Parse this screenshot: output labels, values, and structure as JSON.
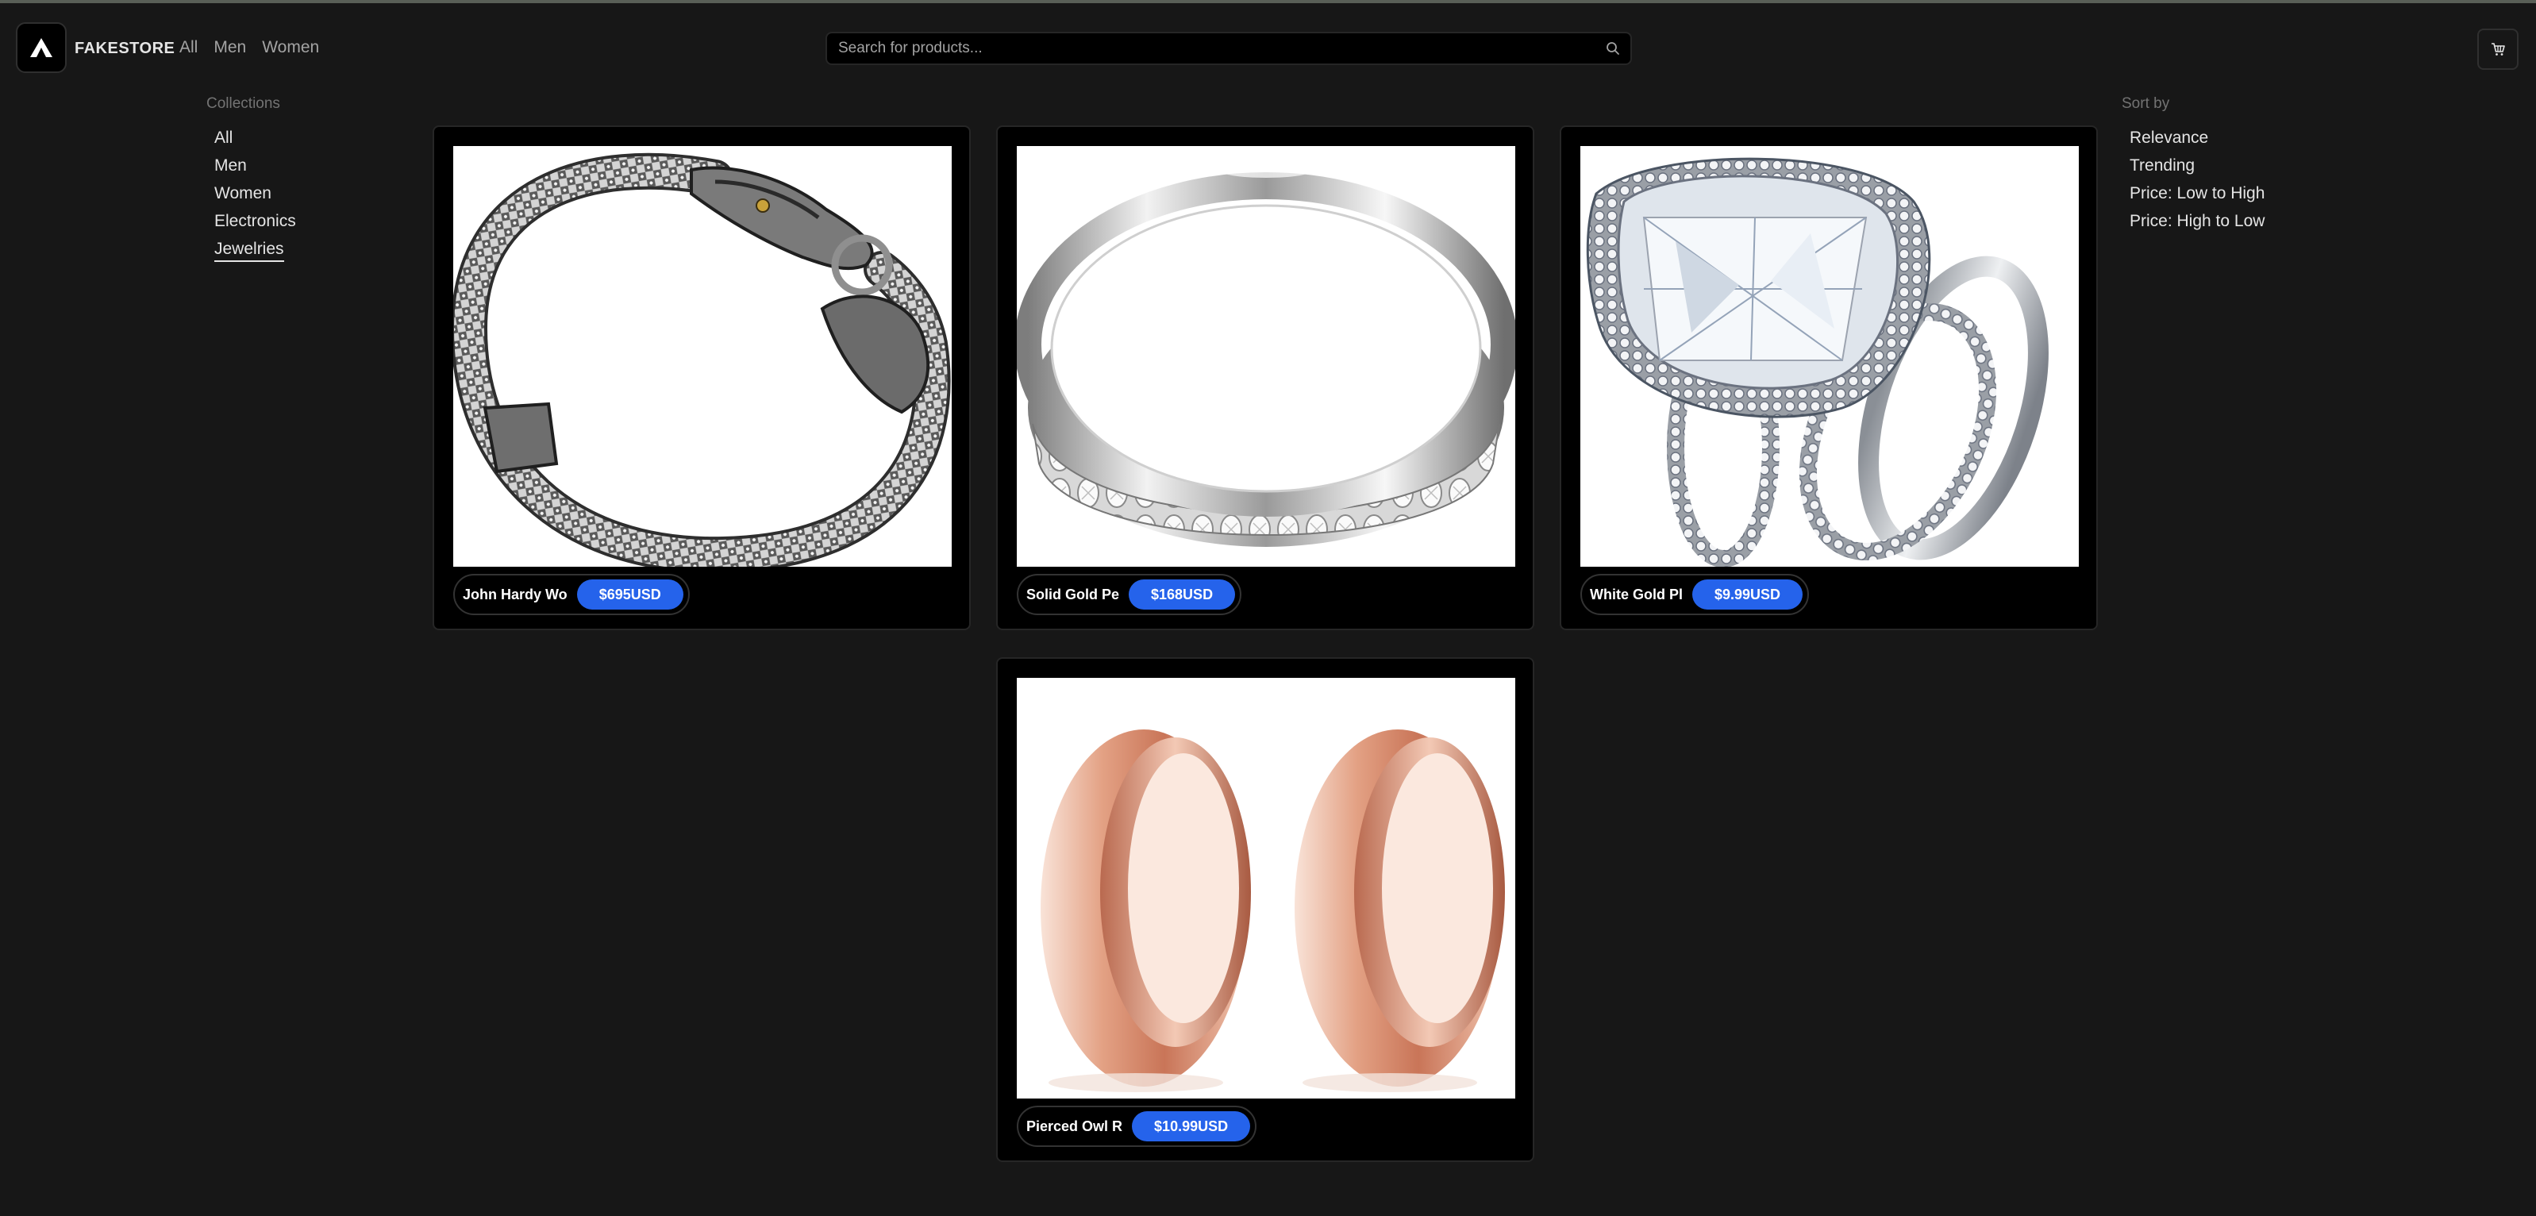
{
  "brand": {
    "name": "FAKESTORE",
    "logo_icon": "triangle-logo-icon"
  },
  "nav": {
    "links": [
      "All",
      "Men",
      "Women"
    ]
  },
  "search": {
    "placeholder": "Search for products...",
    "value": ""
  },
  "collections": {
    "title": "Collections",
    "items": [
      "All",
      "Men",
      "Women",
      "Electronics",
      "Jewelries"
    ],
    "active": "Jewelries"
  },
  "sort": {
    "title": "Sort by",
    "items": [
      "Relevance",
      "Trending",
      "Price: Low to High",
      "Price: High to Low"
    ]
  },
  "products": [
    {
      "title": "John Hardy Wo",
      "price": "$695USD"
    },
    {
      "title": "Solid Gold Pe",
      "price": "$168USD"
    },
    {
      "title": "White Gold Pl",
      "price": "$9.99USD"
    },
    {
      "title": "Pierced Owl R",
      "price": "$10.99USD"
    }
  ],
  "colors": {
    "background": "#171717",
    "card": "#000000",
    "price_badge": "#2563eb"
  }
}
